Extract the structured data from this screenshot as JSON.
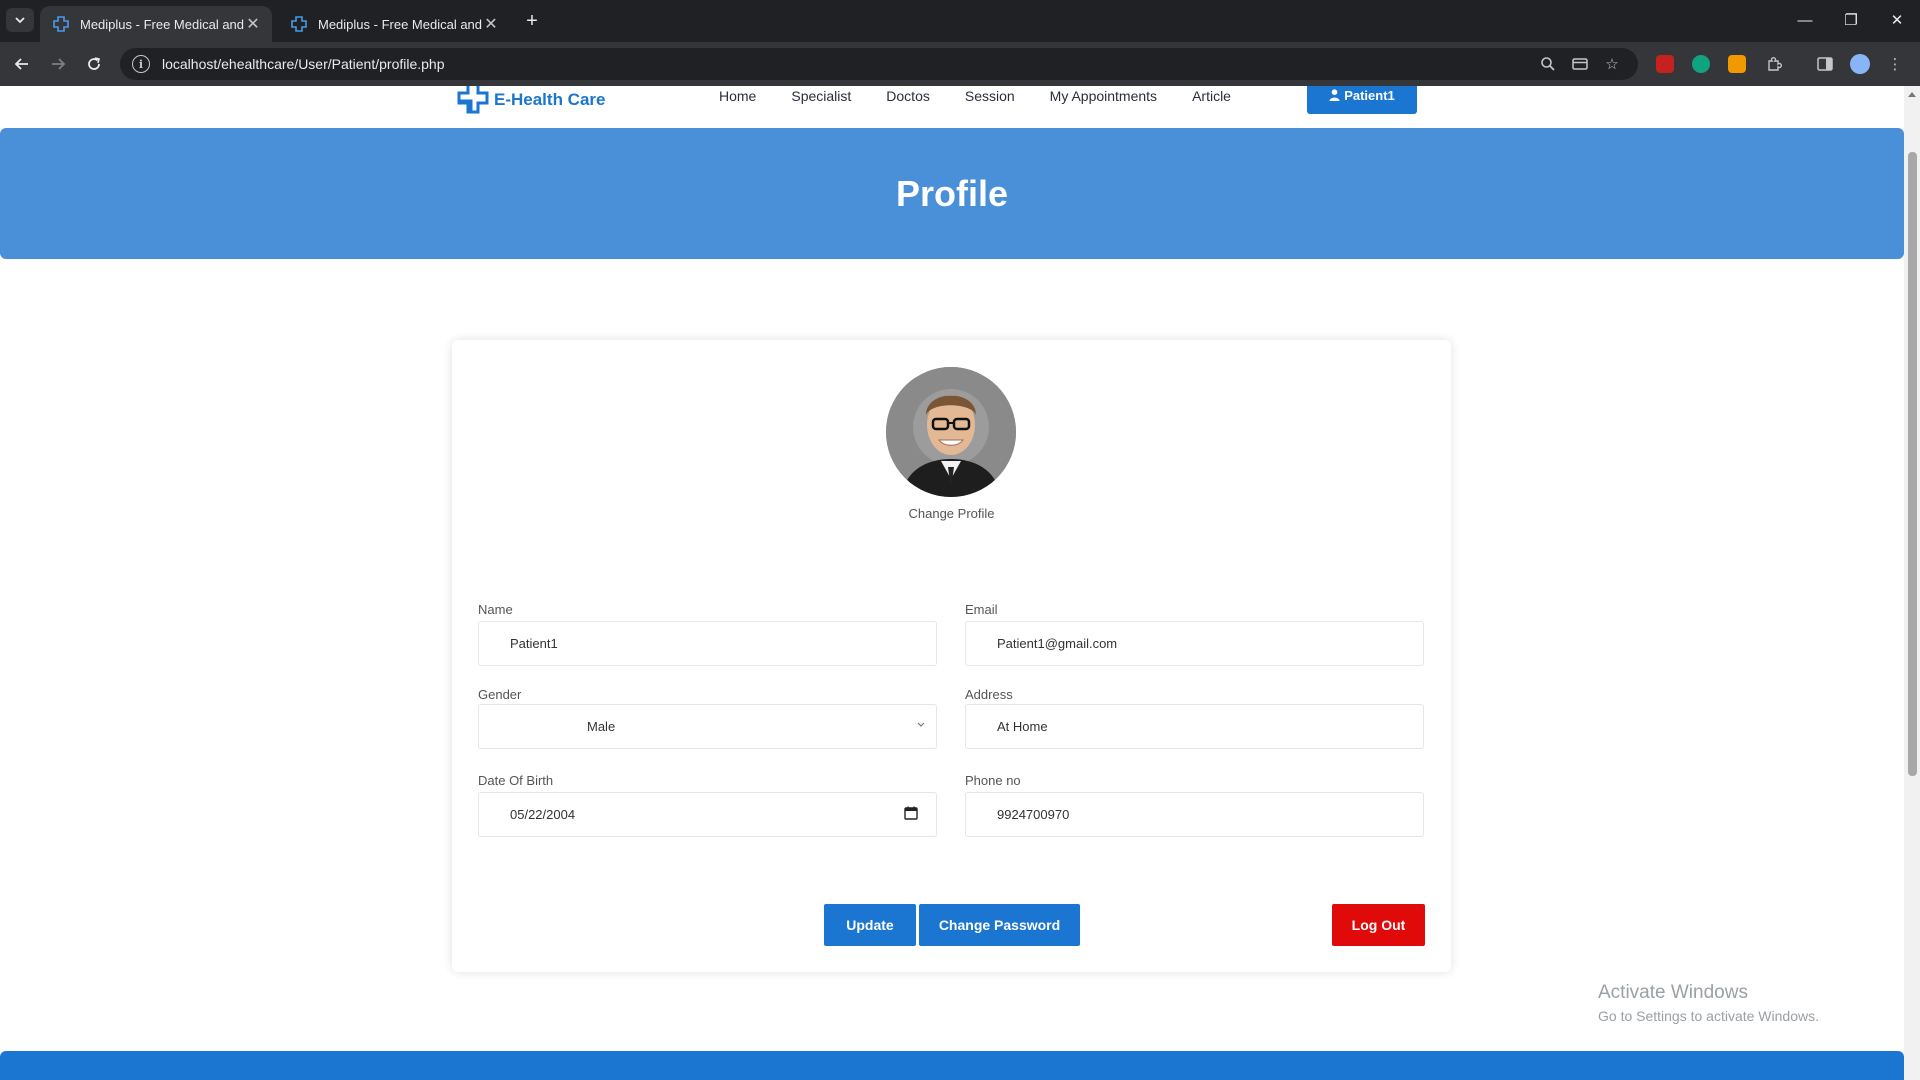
{
  "browser": {
    "tabs": [
      {
        "title": "Mediplus - Free Medical and Do",
        "active": true
      },
      {
        "title": "Mediplus - Free Medical and Do",
        "active": false
      }
    ],
    "url": "localhost/ehealthcare/User/Patient/profile.php"
  },
  "site": {
    "logo_text": "E-Health Care",
    "nav": [
      "Home",
      "Specialist",
      "Doctos",
      "Session",
      "My Appointments",
      "Article"
    ],
    "user_button": "Patient1",
    "accent_color": "#1a76d1"
  },
  "banner": {
    "title": "Profile",
    "color": "#4a90d9"
  },
  "profile": {
    "change_profile": "Change Profile",
    "fields": {
      "name": {
        "label": "Name",
        "value": "Patient1"
      },
      "email": {
        "label": "Email",
        "value": "Patient1@gmail.com"
      },
      "gender": {
        "label": "Gender",
        "value": "Male"
      },
      "address": {
        "label": "Address",
        "value": "At Home"
      },
      "dob": {
        "label": "Date Of Birth",
        "value": "05/22/2004"
      },
      "phone": {
        "label": "Phone no",
        "value": "9924700970"
      }
    },
    "buttons": {
      "update": "Update",
      "change_password": "Change Password",
      "logout": "Log Out"
    }
  },
  "watermark": {
    "line1": "Activate Windows",
    "line2": "Go to Settings to activate Windows."
  }
}
